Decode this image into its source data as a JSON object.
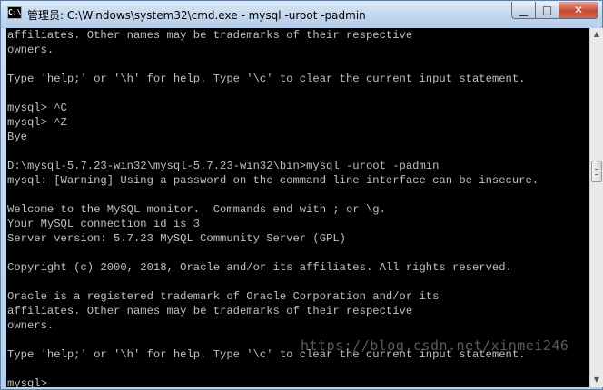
{
  "window": {
    "title": "管理员: C:\\Windows\\system32\\cmd.exe - mysql  -uroot -padmin",
    "icon_label": "C:\\",
    "controls": {
      "minimize": "▁",
      "maximize": "□",
      "close": "✕"
    }
  },
  "console": {
    "lines": [
      "affiliates. Other names may be trademarks of their respective",
      "owners.",
      "",
      "Type 'help;' or '\\h' for help. Type '\\c' to clear the current input statement.",
      "",
      "mysql> ^C",
      "mysql> ^Z",
      "Bye",
      "",
      "D:\\mysql-5.7.23-win32\\mysql-5.7.23-win32\\bin>mysql -uroot -padmin",
      "mysql: [Warning] Using a password on the command line interface can be insecure.",
      "",
      "Welcome to the MySQL monitor.  Commands end with ; or \\g.",
      "Your MySQL connection id is 3",
      "Server version: 5.7.23 MySQL Community Server (GPL)",
      "",
      "Copyright (c) 2000, 2018, Oracle and/or its affiliates. All rights reserved.",
      "",
      "Oracle is a registered trademark of Oracle Corporation and/or its",
      "affiliates. Other names may be trademarks of their respective",
      "owners.",
      "",
      "Type 'help;' or '\\h' for help. Type '\\c' to clear the current input statement.",
      "",
      "mysql>"
    ]
  },
  "scrollbar": {
    "up_arrow": "▲",
    "down_arrow": "▼"
  },
  "watermark": "https://blog.csdn.net/xinmei246"
}
